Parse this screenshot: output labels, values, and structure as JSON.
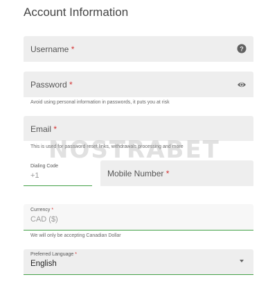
{
  "title": "Account Information",
  "required_mark": "*",
  "username": {
    "label": "Username",
    "icon": "help-circle-icon"
  },
  "password": {
    "label": "Password",
    "icon": "eye-icon",
    "hint": "Avoid using personal information in passwords, it puts you at risk"
  },
  "email": {
    "label": "Email",
    "hint": "This is used for password reset links, withdrawals processing and more"
  },
  "dialing_code": {
    "label": "Dialing Code",
    "value": "+1"
  },
  "mobile": {
    "label": "Mobile Number"
  },
  "currency": {
    "label": "Currency",
    "value": "CAD ($)",
    "hint": "We will only be accepting Canadian Dollar"
  },
  "language": {
    "label": "Preferred Language",
    "value": "English",
    "icon": "chevron-down-icon"
  },
  "watermark": "NOSTRABET",
  "colors": {
    "required": "#d32f2f",
    "accent": "#43a047",
    "field_bg": "#eeeeee"
  }
}
